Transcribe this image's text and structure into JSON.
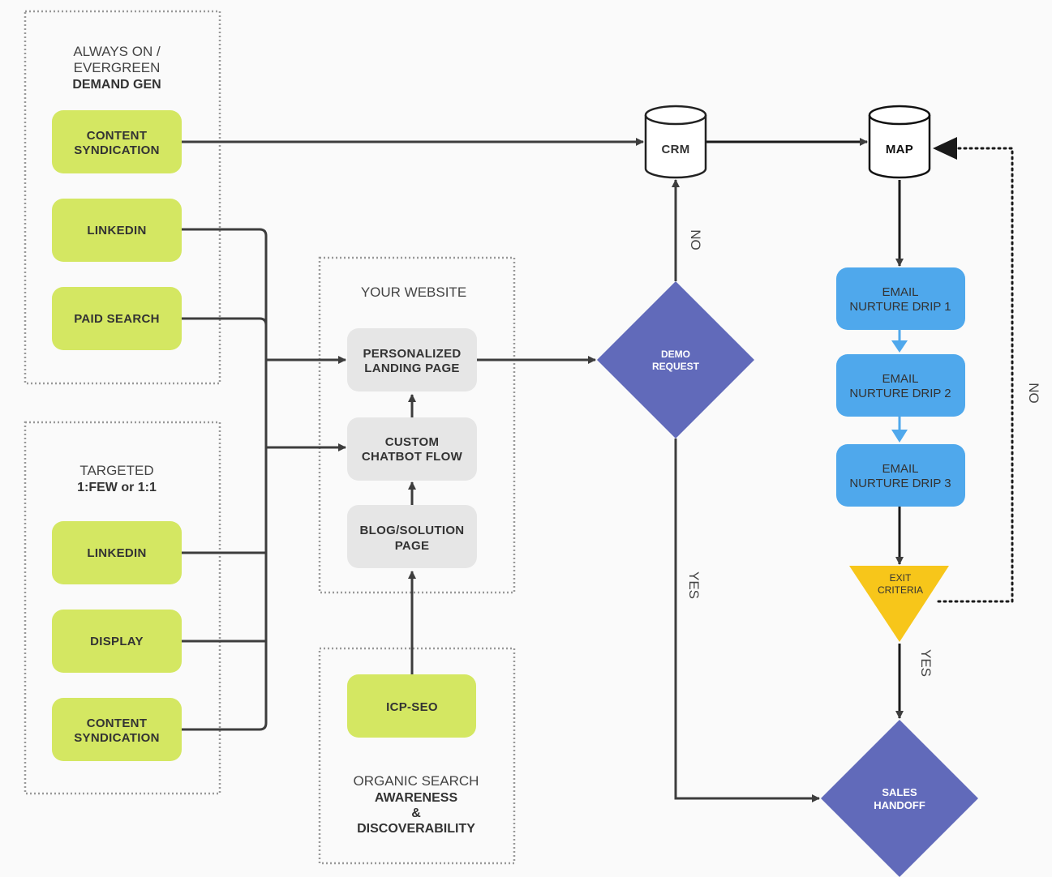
{
  "colors": {
    "source": "#d4e762",
    "website": "#e6e6e6",
    "decision": "#616aba",
    "email": "#4fa8ec",
    "exit": "#f7c61a",
    "line": "#3d3d3d"
  },
  "evergreen": {
    "title": [
      "ALWAYS ON /",
      "EVERGREEN"
    ],
    "title_bold": "DEMAND GEN",
    "items": [
      [
        "CONTENT",
        "SYNDICATION"
      ],
      [
        "LINKEDIN"
      ],
      [
        "PAID SEARCH"
      ]
    ]
  },
  "targeted": {
    "title": "TARGETED",
    "title_bold": "1:FEW or 1:1",
    "items": [
      [
        "LINKEDIN"
      ],
      [
        "DISPLAY"
      ],
      [
        "CONTENT",
        "SYNDICATION"
      ]
    ]
  },
  "website": {
    "title": "YOUR WEBSITE",
    "items": [
      [
        "PERSONALIZED",
        "LANDING PAGE"
      ],
      [
        "CUSTOM",
        "CHATBOT FLOW"
      ],
      [
        "BLOG/SOLUTION",
        "PAGE"
      ]
    ]
  },
  "organic": {
    "item": "ICP-SEO",
    "title": "ORGANIC SEARCH",
    "title_bold": [
      "AWARENESS",
      "&",
      "DISCOVERABILITY"
    ]
  },
  "crm": "CRM",
  "map": "MAP",
  "demo": [
    "DEMO",
    "REQUEST"
  ],
  "emails": [
    [
      "EMAIL",
      "NURTURE DRIP 1"
    ],
    [
      "EMAIL",
      "NURTURE DRIP 2"
    ],
    [
      "EMAIL",
      "NURTURE DRIP 3"
    ]
  ],
  "exit": [
    "EXIT",
    "CRITERIA"
  ],
  "sales": [
    "SALES",
    "HANDOFF"
  ],
  "edges": {
    "demo_no": "NO",
    "demo_yes": "YES",
    "exit_no": "NO",
    "exit_yes": "YES"
  }
}
